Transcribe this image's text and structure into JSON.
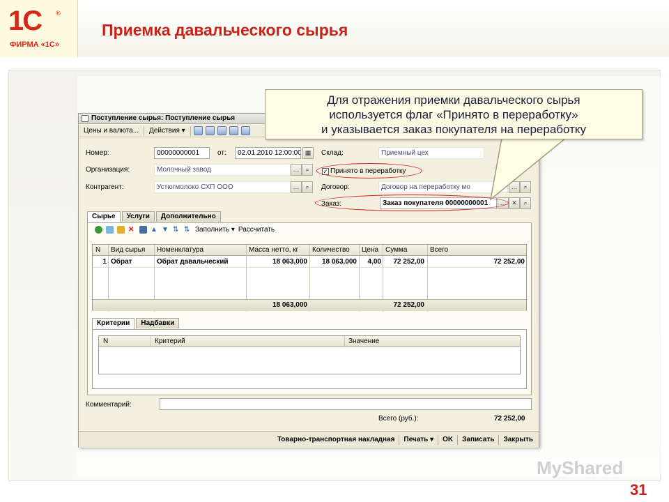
{
  "slide": {
    "logo": {
      "mark": "1C",
      "registered": "®",
      "firm": "ФИРМА «1С»"
    },
    "title": "Приемка давальческого сырья",
    "callout": {
      "line1": "Для отражения приемки давальческого сырья",
      "line2": "используется флаг «Принято в переработку»",
      "line3": "и указывается заказ покупателя на переработку"
    },
    "watermark": "MyShared",
    "page_number": "31",
    "accent_color": "#c8231b"
  },
  "window": {
    "title": "Поступление сырья: Поступление сырья",
    "menu": {
      "prices": "Цены и валюта...",
      "actions": "Действия"
    },
    "labels": {
      "number": "Номер:",
      "from": "от:",
      "organization": "Организация:",
      "counterparty": "Контрагент:",
      "warehouse": "Склад:",
      "contract": "Договор:",
      "order": "Заказ:",
      "comment": "Комментарий:",
      "total": "Всего (руб.):"
    },
    "values": {
      "number": "00000000001",
      "date": "02.01.2010 12:00:00",
      "organization": "Молочный завод",
      "counterparty": "Устюгмолоко СХП ООО",
      "warehouse": "Приемный цех",
      "contract": "Договор на переработку мо",
      "order": "Заказ покупателя 00000000001",
      "comment": "",
      "total": "72 252,00"
    },
    "checkbox": {
      "label": "Принято в переработку",
      "checked": true
    },
    "tabs": [
      "Сырье",
      "Услуги",
      "Дополнительно"
    ],
    "table_toolbar": {
      "fill": "Заполнить",
      "calc": "Рассчитать"
    },
    "table": {
      "columns": [
        "N",
        "Вид сырья",
        "Номенклатура",
        "Масса нетто, кг",
        "Количество",
        "Цена",
        "Сумма",
        "Всего"
      ],
      "rows": [
        [
          "1",
          "Обрат",
          "Обрат давальческий",
          "18 063,000",
          "18 063,000",
          "4,00",
          "72 252,00",
          "72 252,00"
        ]
      ],
      "totals": {
        "mass": "18 063,000",
        "sum": "72 252,00"
      }
    },
    "lower_tabs": [
      "Критерии",
      "Надбавки"
    ],
    "criteria_table": {
      "columns": [
        "N",
        "Критерий",
        "Значение"
      ]
    },
    "bottom_buttons": {
      "waybill": "Товарно-транспортная накладная",
      "print": "Печать",
      "ok": "OK",
      "save": "Записать",
      "close": "Закрыть"
    }
  }
}
